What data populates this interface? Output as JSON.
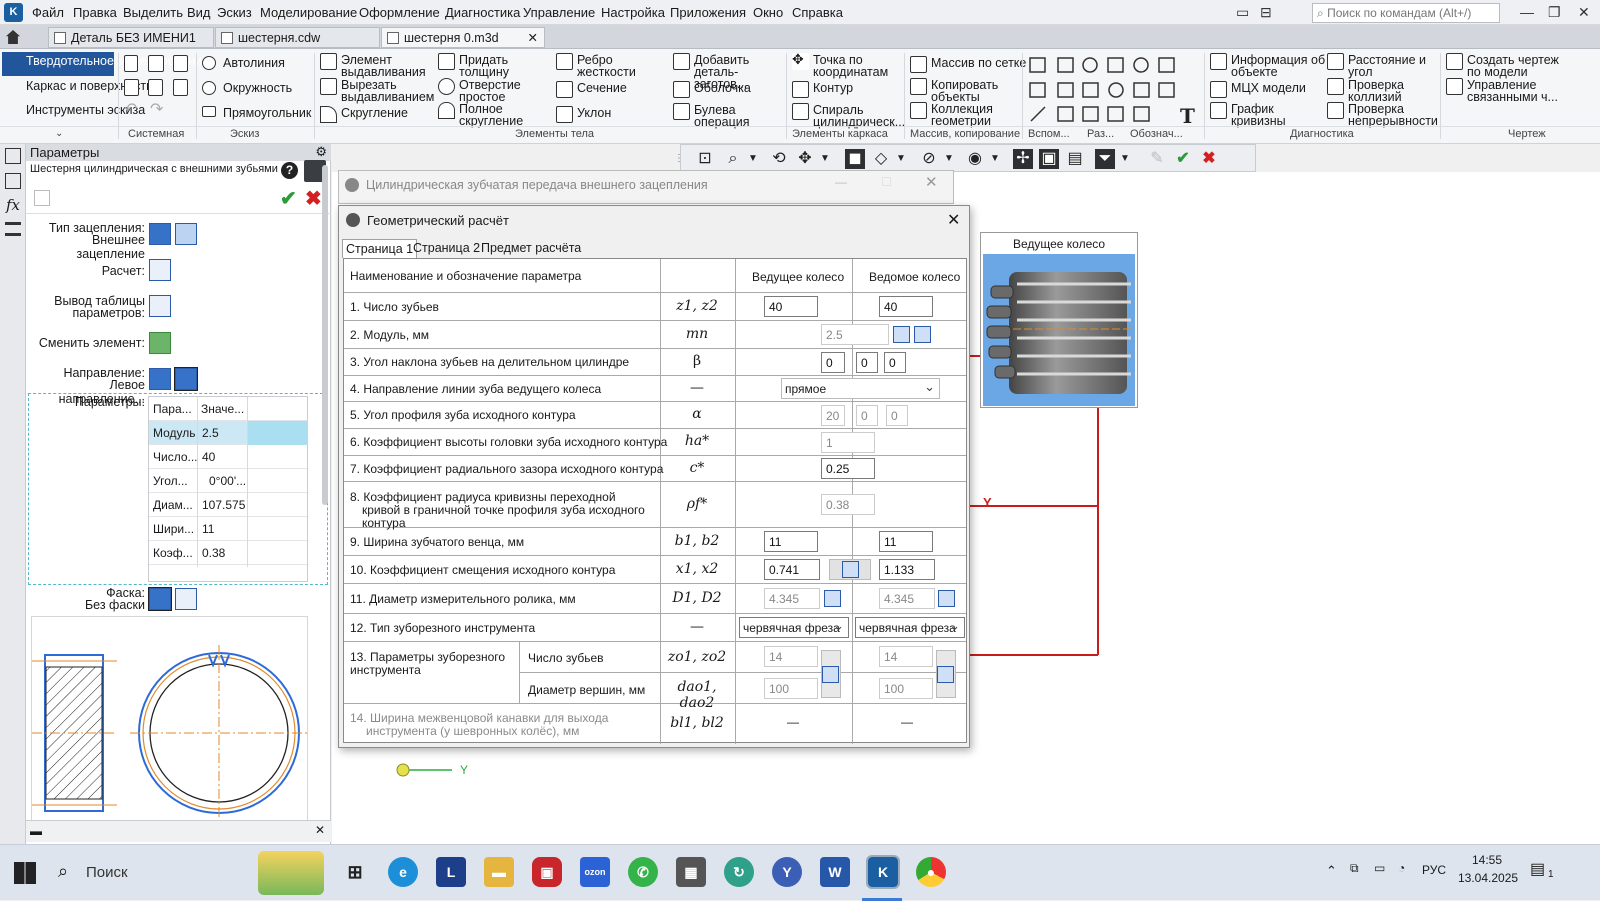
{
  "app": {
    "logo": "K"
  },
  "menu": [
    "Файл",
    "Правка",
    "Выделить",
    "Вид",
    "Эскиз",
    "Моделирование",
    "Оформление",
    "Диагностика",
    "Управление",
    "Настройка",
    "Приложения",
    "Окно",
    "Справка"
  ],
  "search": {
    "placeholder": "Поиск по командам (Alt+/)"
  },
  "tabs": [
    "Деталь БЕЗ ИМЕНИ1",
    "шестерня.cdw",
    "шестерня 0.m3d"
  ],
  "ribbon": {
    "left": [
      "Твердотельное моделирование",
      "Каркас и поверхности",
      "Инструменты эскиза"
    ],
    "sketch": [
      "Автолиния",
      "Окружность",
      "Прямоугольник"
    ],
    "body1": [
      "Элемент выдавливания",
      "Вырезать выдавливанием",
      "Скругление"
    ],
    "body2": [
      "Придать толщину",
      "Отверстие простое",
      "Полное скругление"
    ],
    "body3": [
      "Ребро жесткости",
      "Сечение",
      "Уклон"
    ],
    "body4": [
      "Добавить деталь-заготов...",
      "Оболочка",
      "Булева операция"
    ],
    "frame": [
      "Точка по координатам",
      "Контур",
      "Спираль цилиндрическ..."
    ],
    "array": [
      "Массив по сетке",
      "Копировать объекты",
      "Коллекция геометрии"
    ],
    "diag1": [
      "Информация об объекте",
      "МЦХ модели",
      "График кривизны"
    ],
    "diag2": [
      "Расстояние и угол",
      "Проверка коллизий",
      "Проверка непрерывности"
    ],
    "draw": [
      "Создать чертеж по модели",
      "Управление связанными ч..."
    ],
    "groups": [
      "Системная",
      "Эскиз",
      "Элементы тела",
      "Элементы каркаса",
      "Массив, копирование",
      "Вспом...",
      "Раз...",
      "Обознач...",
      "Диагностика",
      "Чертеж"
    ]
  },
  "params": {
    "title": "Параметры",
    "object": "Шестерня цилиндрическая с внешними зубьями",
    "mesh_label": "Тип зацепления:",
    "mesh_value": "Внешнее зацепление",
    "calc": "Расчет:",
    "table_out": "Вывод таблицы параметров:",
    "change": "Сменить элемент:",
    "dir_label": "Направление:",
    "dir_value": "Левое направление...",
    "params_label": "Параметры:",
    "table_head": [
      "Пара...",
      "Значе..."
    ],
    "table": [
      [
        "Модуль",
        "2.5"
      ],
      [
        "Число...",
        "40"
      ],
      [
        "Угол...",
        "0°00'..."
      ],
      [
        "Диам...",
        "107.575"
      ],
      [
        "Шири...",
        "11"
      ],
      [
        "Коэф...",
        "0.38"
      ]
    ],
    "chamfer_label": "Фаска:",
    "chamfer_value": "Без фаски"
  },
  "outer_dialog": {
    "title": "Цилиндрическая зубчатая передача внешнего зацепления"
  },
  "dialog": {
    "title": "Геометрический расчёт",
    "tabs": [
      "Страница 1",
      "Страница 2",
      "Предмет расчёта"
    ],
    "header": {
      "name": "Наименование и обозначение параметра",
      "drive": "Ведущее колесо",
      "driven": "Ведомое колесо"
    },
    "rows": [
      {
        "n": "1. Число зубьев",
        "s": "z1, z2",
        "a": "40",
        "b": "40"
      },
      {
        "n": "2. Модуль, мм",
        "s": "mn",
        "v": "2.5"
      },
      {
        "n": "3. Угол наклона зубьев на делительном цилиндре",
        "s": "β",
        "d": "0",
        "m": "0",
        "sec": "0"
      },
      {
        "n": "4. Направление линии зуба ведущего колеса",
        "s": "—",
        "v": "прямое"
      },
      {
        "n": "5. Угол профиля зуба исходного контура",
        "s": "α",
        "d": "20",
        "m": "0",
        "sec": "0"
      },
      {
        "n": "6. Коэффициент высоты головки зуба исходного контура",
        "s": "ha*",
        "v": "1"
      },
      {
        "n": "7. Коэффициент радиального зазора исходного контура",
        "s": "c*",
        "v": "0.25"
      },
      {
        "n": "8. Коэффициент радиуса кривизны переходной кривой в граничной точке профиля зуба исходного контура",
        "s": "ρf*",
        "v": "0.38"
      },
      {
        "n": "9. Ширина зубчатого венца, мм",
        "s": "b1, b2",
        "a": "11",
        "b": "11"
      },
      {
        "n": "10. Коэффициент смещения исходного контура",
        "s": "x1, x2",
        "a": "0.741",
        "b": "1.133"
      },
      {
        "n": "11. Диаметр измерительного ролика, мм",
        "s": "D1, D2",
        "a": "4.345",
        "b": "4.345"
      },
      {
        "n": "12. Тип зуборезного инструмента",
        "s": "—",
        "a": "червячная фреза",
        "b": "червячная фреза"
      },
      {
        "n": "13. Параметры зуборезного инструмента",
        "sub1": "Число зубьев",
        "s1": "zo1, zo2",
        "a1": "14",
        "b1": "14",
        "sub2": "Диаметр вершин, мм",
        "s2": "dao1, dao2",
        "a2": "100",
        "b2": "100"
      },
      {
        "n": "14. Ширина межвенцовой канавки для выхода инструмента (у шевронных колёс), мм",
        "s": "bl1, bl2",
        "a": "—",
        "b": "—"
      }
    ]
  },
  "preview": {
    "title": "Ведущее колесо"
  },
  "canvas": {
    "axis_y": "Y",
    "axis_y2": "Y"
  },
  "taskbar": {
    "search": "Поиск",
    "lang": "РУС",
    "time": "14:55",
    "date": "13.04.2025",
    "notif": "1"
  }
}
